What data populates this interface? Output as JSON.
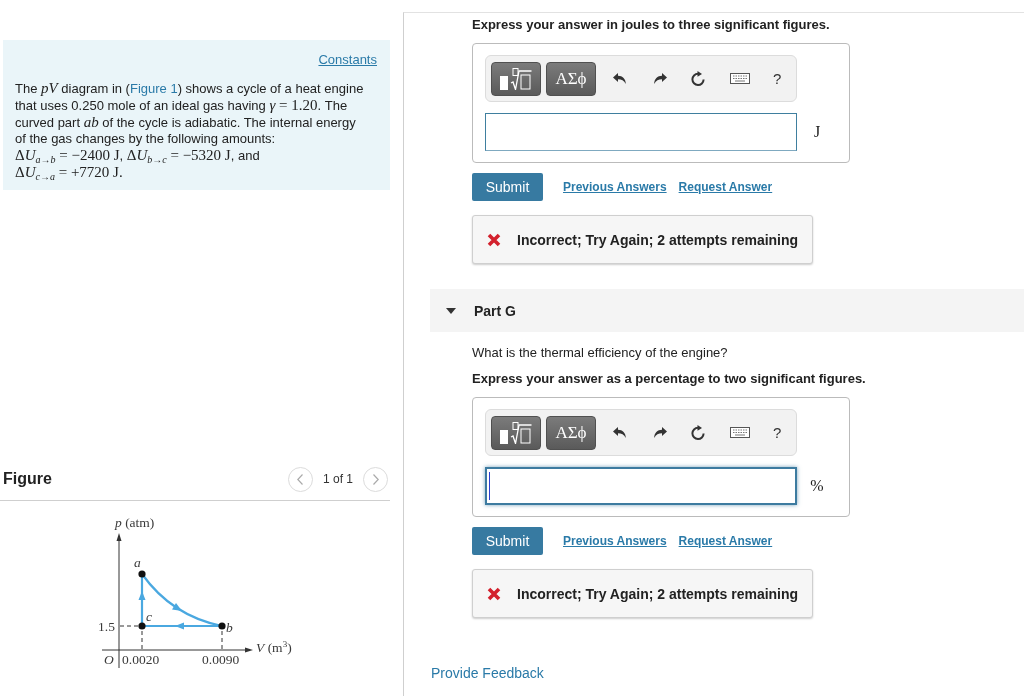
{
  "problem": {
    "constants_link": "Constants",
    "text": [
      {
        "kind": "text",
        "text": "The "
      },
      {
        "kind": "math",
        "runs": [
          "*pV*"
        ]
      },
      {
        "kind": "text",
        "text": " diagram in ("
      },
      {
        "kind": "link",
        "text": "Figure 1"
      },
      {
        "kind": "text",
        "text": ") shows a cycle of a heat engine that uses 0.250 mole of an ideal gas having "
      },
      {
        "kind": "math",
        "runs": [
          "*γ*",
          " = 1.20"
        ]
      },
      {
        "kind": "text",
        "text": ". The curved part "
      },
      {
        "kind": "math",
        "runs": [
          "*ab*"
        ]
      },
      {
        "kind": "text",
        "text": " of the cycle is adiabatic. The internal energy of the gas changes by the following amounts: "
      },
      {
        "kind": "math",
        "runs": [
          "Δ",
          "*U*",
          "$_{a→b}$",
          " = −2400 J"
        ]
      },
      {
        "kind": "text",
        "text": ", "
      },
      {
        "kind": "math",
        "runs": [
          "Δ",
          "*U*",
          "$_{b→c}$",
          " = −5320 J"
        ]
      },
      {
        "kind": "text",
        "text": ", and "
      },
      {
        "kind": "math",
        "runs": [
          "Δ",
          "*U*",
          "$_{c→a}$",
          " = +7720 J."
        ]
      }
    ]
  },
  "figure": {
    "heading": "Figure",
    "pager": "1 of 1",
    "diagram": {
      "y_axis_label": "*p* (atm)",
      "x_axis_label": "*V* (m$^{3}$)",
      "origin": "O",
      "y_ticks": [
        "1.5"
      ],
      "x_ticks": [
        "0.0020",
        "0.0090"
      ],
      "points": [
        {
          "label": "a"
        },
        {
          "label": "b"
        },
        {
          "label": "c"
        }
      ]
    }
  },
  "parts": [
    {
      "instruction": "Express your answer in joules to three significant figures.",
      "toolbar": {
        "symbols": "ΑΣϕ",
        "help": "?"
      },
      "input": {
        "focused": false
      },
      "unit": "J",
      "submit": "Submit",
      "links": [
        "Previous Answers",
        "Request Answer"
      ],
      "feedback": {
        "correct": false,
        "text": "Incorrect; Try Again; 2 attempts remaining"
      }
    },
    {
      "title": "Part G",
      "expanded": true,
      "question": "What is the thermal efficiency of the engine?",
      "instruction": "Express your answer as a percentage to two significant figures.",
      "toolbar": {
        "symbols": "ΑΣϕ",
        "help": "?"
      },
      "input": {
        "focused": true
      },
      "unit": "%",
      "submit": "Submit",
      "links": [
        "Previous Answers",
        "Request Answer"
      ],
      "feedback": {
        "correct": false,
        "text": "Incorrect; Try Again; 2 attempts remaining"
      }
    }
  ],
  "footer_link": "Provide Feedback"
}
